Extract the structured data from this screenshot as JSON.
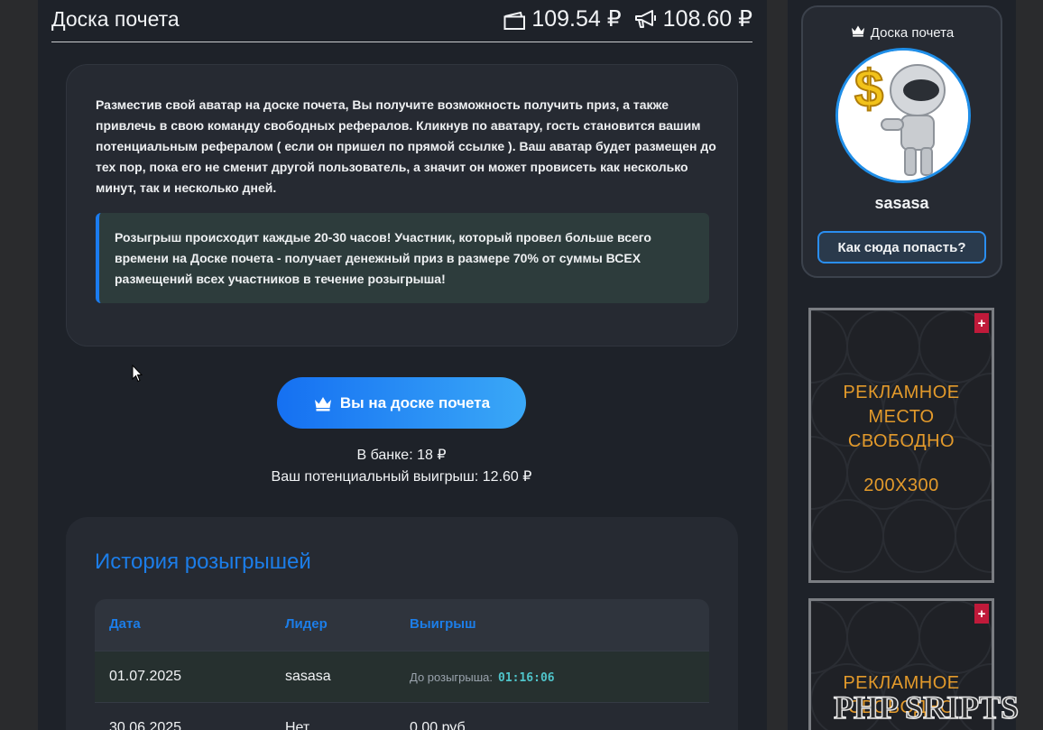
{
  "header": {
    "title": "Доска почета",
    "wallet_balance": "109.54 ₽",
    "ads_balance": "108.60 ₽"
  },
  "info": {
    "description": "Разместив свой аватар на доске почета, Вы получите возможность получить приз, а также привлечь в свою команду свободных рефералов. Кликнув по аватару, гость становится вашим потенциальным рефералом ( если он пришел по прямой ссылке ). Ваш аватар будет размещен до тех пор, пока его не сменит другой пользователь, а значит он может провисеть как несколько минут, так и несколько дней.",
    "notice": "Розыгрыш происходит каждые 20-30 часов! Участник, который провел больше всего времени на Доске почета - получает денежный приз в размере 70% от суммы ВСЕХ размещений всех участников в течение розыгрыша!"
  },
  "action": {
    "board_button_label": "Вы на доске почета",
    "bank": "В банке: 18 ₽",
    "potential_win": "Ваш потенциальный выигрыш: 12.60 ₽"
  },
  "history": {
    "title": "История розыгрышей",
    "columns": [
      "Дата",
      "Лидер",
      "Выигрыш"
    ],
    "rows": [
      {
        "date": "01.07.2025",
        "leader": "sasasa",
        "countdown_label": "До розыгрыша:",
        "countdown": "01:16:06"
      },
      {
        "date": "30.06.2025",
        "leader": "Нет",
        "prize": "0.00 руб"
      }
    ]
  },
  "sidebar": {
    "board_title": "Доска почета",
    "leader_name": "sasasa",
    "how_button_label": "Как сюда попасть?",
    "ads": [
      {
        "line1": "РЕКЛАМНОЕ",
        "line2": "МЕСТО",
        "line3": "СВОБОДНО",
        "size": "200X300",
        "plus": "+"
      },
      {
        "line1": "РЕКЛАМНОЕ",
        "line2": "СВОБОДНО",
        "plus": "+"
      }
    ]
  },
  "watermark": "PHP SRIPTS",
  "colors": {
    "accent": "#1c7de8",
    "ad_text": "#e39a2b",
    "panel": "#262a32",
    "background": "#1e2229"
  }
}
